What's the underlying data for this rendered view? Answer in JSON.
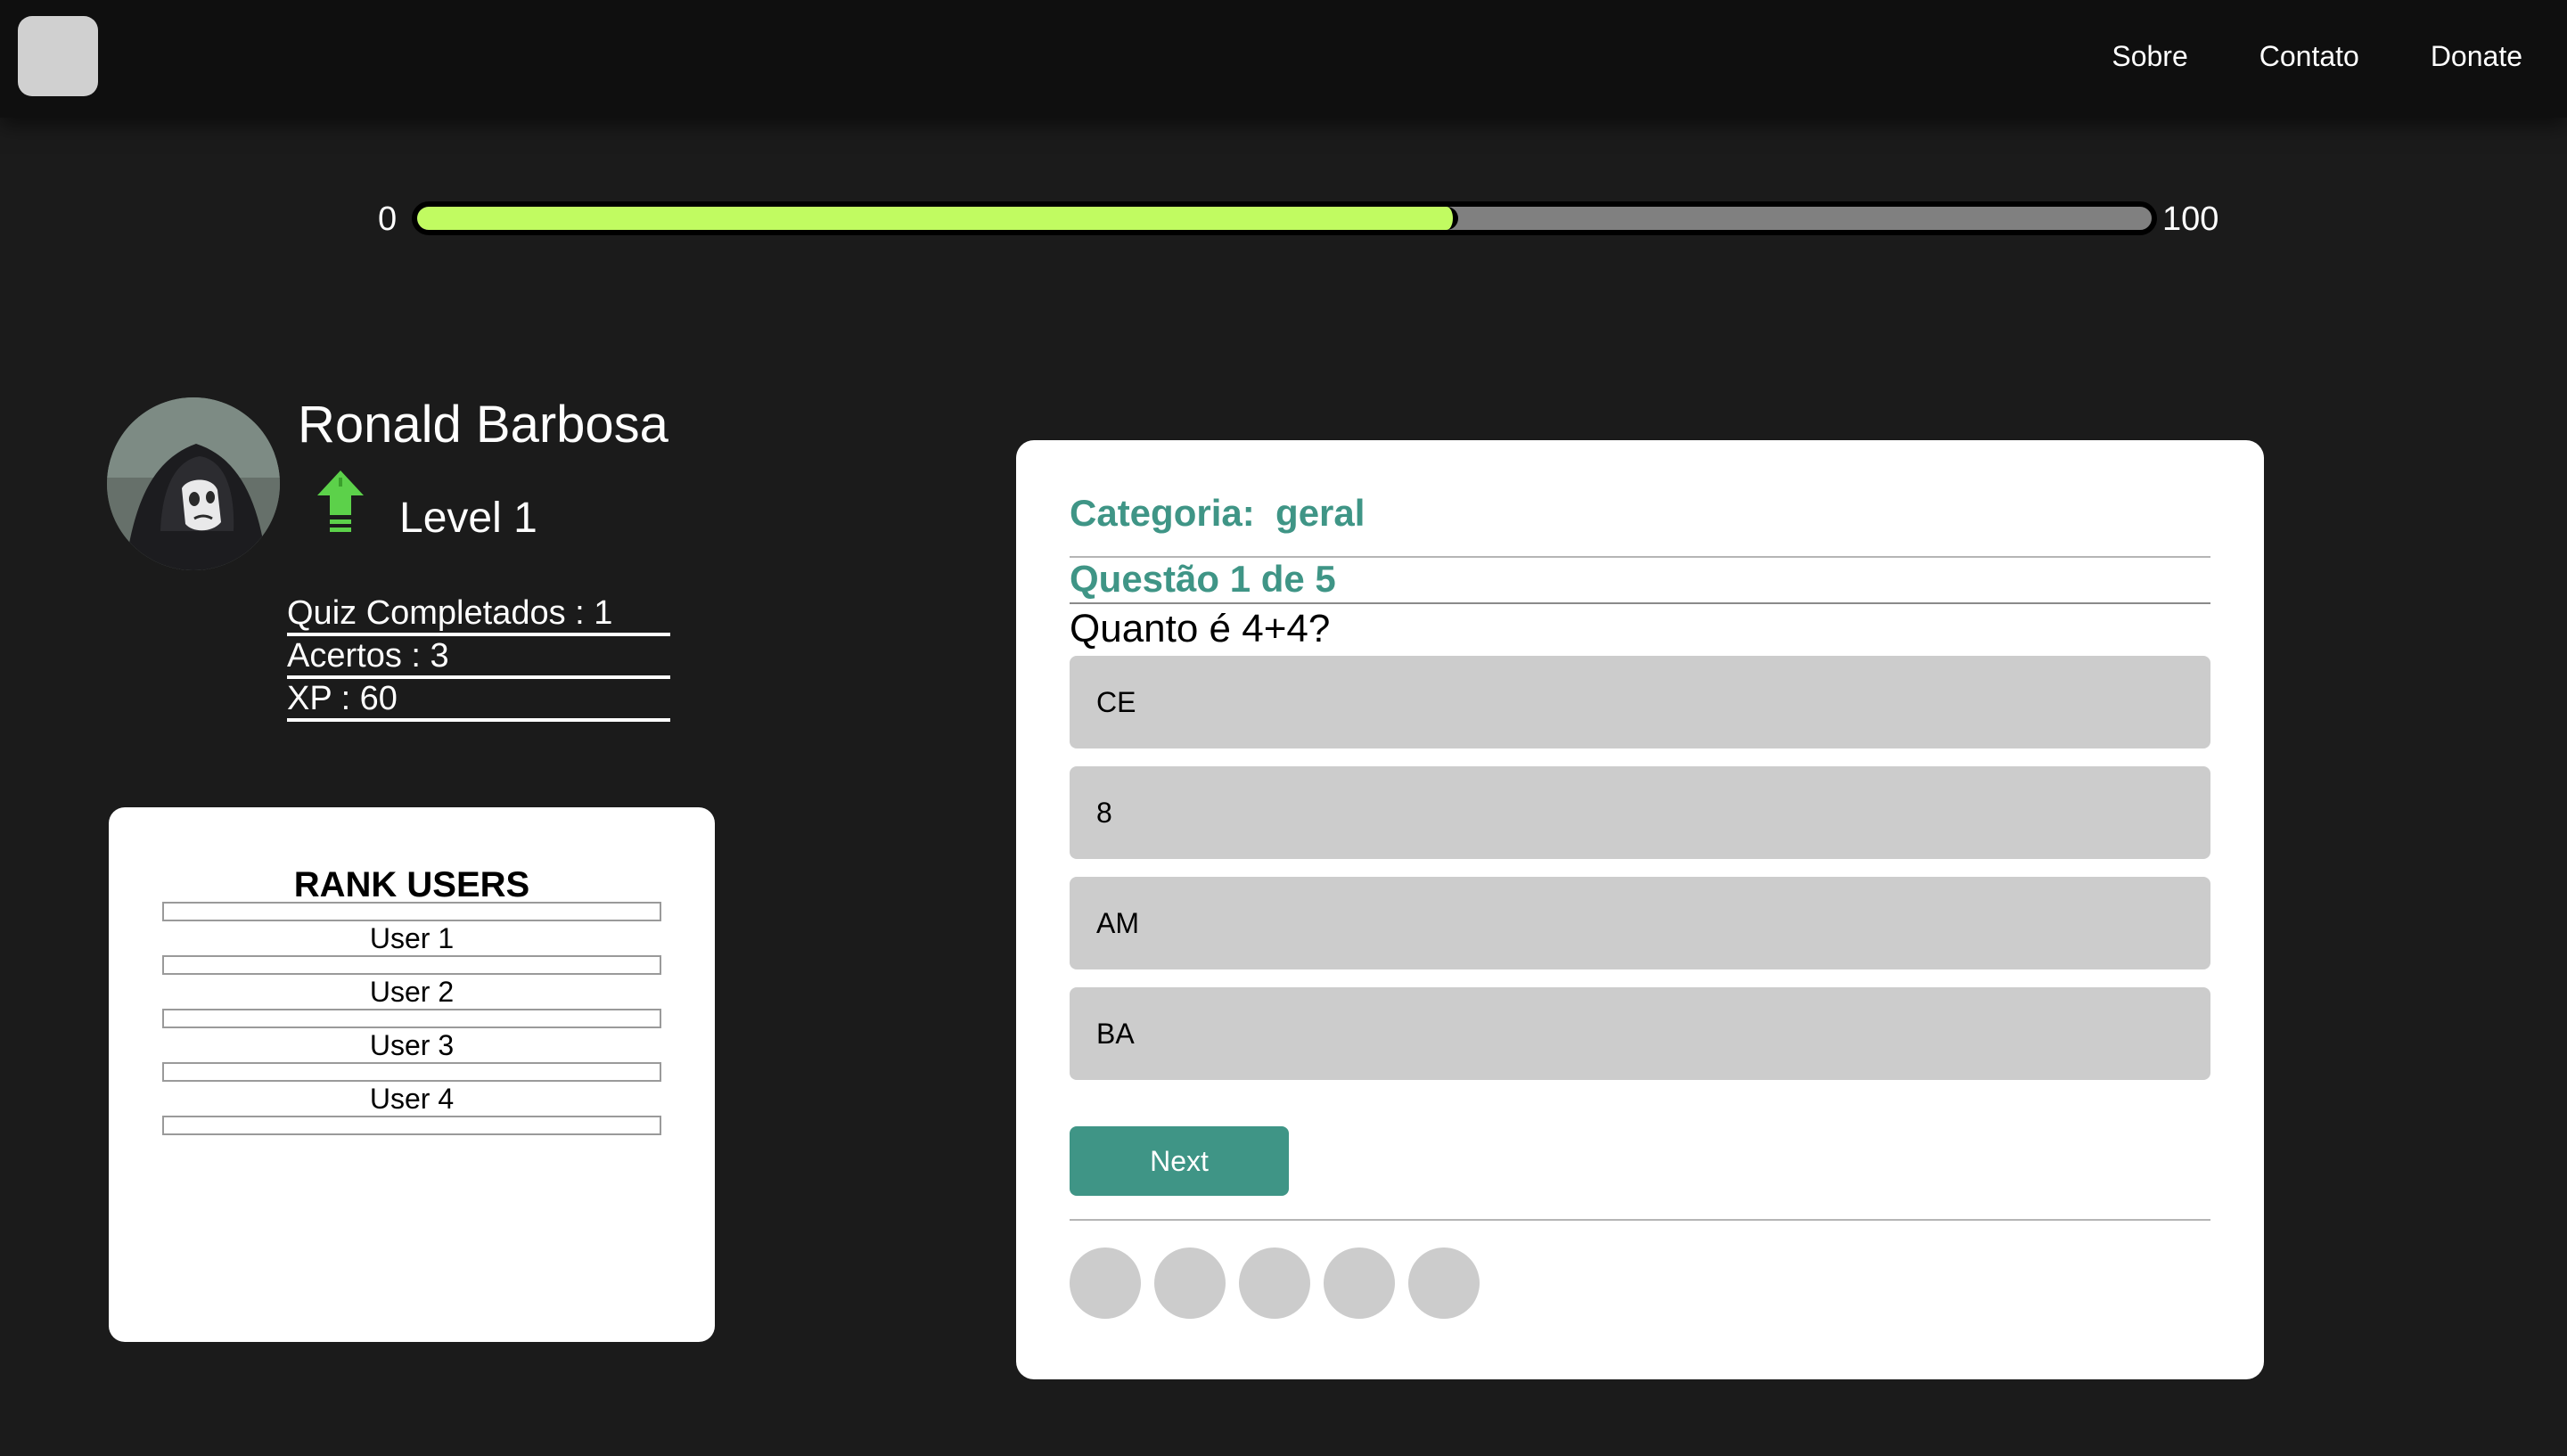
{
  "navbar": {
    "links": [
      "Sobre",
      "Contato",
      "Donate"
    ]
  },
  "progress": {
    "min_label": "0",
    "max_label": "100",
    "value": 60
  },
  "profile": {
    "name": "Ronald Barbosa",
    "level_label": "Level 1",
    "level_icon": "level-up-arrow-icon",
    "level_icon_color": "#5cd14a",
    "stats": [
      "Quiz Completados : 1",
      "Acertos : 3",
      "XP : 60"
    ]
  },
  "rank": {
    "title": "RANK USERS",
    "users": [
      "User 1",
      "User 2",
      "User 3",
      "User 4"
    ]
  },
  "quiz": {
    "category_label": "Categoria:",
    "category_value": "geral",
    "question_number": "Questão 1 de 5",
    "question_text": "Quanto é 4+4?",
    "options": [
      "CE",
      "8",
      "AM",
      "BA"
    ],
    "next_label": "Next",
    "progress_dots": 5
  },
  "colors": {
    "accent": "#3f9586",
    "progress_fill": "#c1fb61",
    "background": "#1b1b1b",
    "navbar": "#0f0f0f"
  }
}
